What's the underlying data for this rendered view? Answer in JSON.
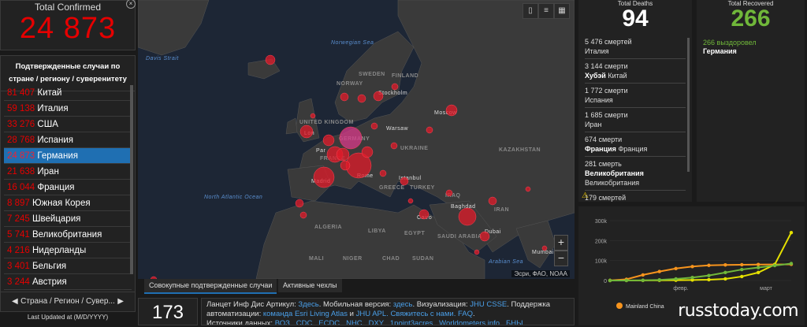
{
  "total_confirmed": {
    "label": "Total Confirmed",
    "value": "24 873"
  },
  "country_list": {
    "header": "Подтвержденные случаи по стране / региону / суверенитету",
    "rows": [
      {
        "value": "81 407",
        "name": "Китай"
      },
      {
        "value": "59 138",
        "name": "Италия"
      },
      {
        "value": "33 276",
        "name": "США"
      },
      {
        "value": "28 768",
        "name": "Испания"
      },
      {
        "value": "24 873",
        "name": "Германия",
        "selected": true
      },
      {
        "value": "21 638",
        "name": "Иран"
      },
      {
        "value": "16 044",
        "name": "Франция"
      },
      {
        "value": "8 897",
        "name": "Южная Корея"
      },
      {
        "value": "7 245",
        "name": "Швейцария"
      },
      {
        "value": "5 741",
        "name": "Великобритания"
      },
      {
        "value": "4 216",
        "name": "Нидерланды"
      },
      {
        "value": "3 401",
        "name": "Бельгия"
      },
      {
        "value": "3 244",
        "name": "Австрия"
      }
    ],
    "footer": "Страна / Регион / Сувер..."
  },
  "last_updated": {
    "label": "Last Updated at (M/D/YYYY)"
  },
  "map": {
    "labels": {
      "norwegian_sea": "Norwegian Sea",
      "davis_strait": "Davis Strait",
      "north_atlantic": "North Atlantic Ocean",
      "arabian_sea": "Arabian Sea",
      "norway": "NORWAY",
      "sweden": "SWEDEN",
      "finland": "FINLAND",
      "stockholm": "Stockholm",
      "moscow": "Moscow",
      "warsaw": "Warsaw",
      "uk": "UNITED KINGDOM",
      "france": "FRANCE",
      "germany": "GERMANY",
      "ukraine": "UKRAINE",
      "kazakhstan": "KAZAKHSTAN",
      "madrid": "Madrid",
      "greece": "GREECE",
      "turkey": "TURKEY",
      "istanbul": "Istanbul",
      "iraq": "IRAQ",
      "baghdad": "Baghdad",
      "algeria": "ALGERIA",
      "libya": "LIBYA",
      "egypt": "EGYPT",
      "saudi": "SAUDI ARABIA",
      "cairo": "Cairo",
      "dubai": "Dubai",
      "mali": "MALI",
      "niger": "NIGER",
      "chad": "CHAD",
      "sudan": "SUDAN",
      "mumbai": "Mumbai",
      "lon": "Lon",
      "par": "Par",
      "rome": "Rome",
      "iran": "IRAN"
    },
    "attribution": "Эсри, ФАО, NOAA",
    "zoom_in": "+",
    "zoom_out": "−"
  },
  "tabs": {
    "cumulative": "Совокупные подтвержденные случаи",
    "active": "Активные чехлы"
  },
  "country_count": "173",
  "info": {
    "line1_a": "Ланцет Инф Дис Артикул:",
    "line1_b": "Здесь",
    "line1_c": ". Мобильная версия:",
    "line1_d": "здесь",
    "line1_e": ". Визуализация:",
    "line1_f": "JHU CSSE",
    "line1_g": ". Поддержка",
    "line2_a": "автоматизации:",
    "line2_b": "команда Esri Living Atlas",
    "line2_c": "и",
    "line2_d": "JHU APL",
    "line2_e": ". Свяжитесь с нами",
    "line2_f": ". FAQ",
    "line2_g": ".",
    "line3_a": "Источники данных:",
    "line3_b": "ВОЗ , CDC , ECDC , NHC , DXY , 1point3acres , Worldometers.info , БНЫ"
  },
  "total_deaths": {
    "label": "Total Deaths",
    "value": "94"
  },
  "deaths_list": [
    {
      "count": "5 476",
      "unit": "смертей",
      "region": "",
      "country": "Италия"
    },
    {
      "count": "3 144",
      "unit": "смерти",
      "region": "Хубэй",
      "country": "Китай"
    },
    {
      "count": "1 772",
      "unit": "смерти",
      "region": "",
      "country": "Испания"
    },
    {
      "count": "1 685",
      "unit": "смерти",
      "region": "",
      "country": "Иран"
    },
    {
      "count": "674",
      "unit": "смерти",
      "region": "Франция",
      "country": "Франция"
    },
    {
      "count": "281",
      "unit": "смерть",
      "region": "Великобритания",
      "country": "Великобритания"
    },
    {
      "count": "179",
      "unit": "смертей",
      "region": "",
      "country": ""
    }
  ],
  "total_recovered": {
    "label": "Total Recovered",
    "value": "266"
  },
  "recovered_list": [
    {
      "count": "266",
      "unit": "выздоровел",
      "country": "Германия"
    }
  ],
  "chart_data": {
    "type": "line",
    "y_ticks": [
      "0",
      "100k",
      "200k",
      "300k"
    ],
    "x_ticks": [
      "февр.",
      "март"
    ],
    "ylim": [
      0,
      300000
    ],
    "legend": [
      "Mainland China"
    ],
    "series": [
      {
        "name": "Mainland China",
        "color": "#f7941d",
        "x": [
          0,
          5,
          10,
          15,
          20,
          25,
          30,
          35,
          40,
          45,
          50,
          55
        ],
        "y": [
          500,
          6000,
          28000,
          45000,
          60000,
          70000,
          76000,
          78000,
          79000,
          80000,
          80500,
          81000
        ]
      },
      {
        "color": "#e5e000",
        "x": [
          0,
          5,
          10,
          15,
          20,
          25,
          30,
          35,
          40,
          45,
          50,
          55
        ],
        "y": [
          0,
          100,
          500,
          1000,
          1500,
          2500,
          4000,
          8000,
          20000,
          40000,
          80000,
          240000
        ]
      },
      {
        "color": "#70b73a",
        "x": [
          0,
          5,
          10,
          15,
          20,
          25,
          30,
          35,
          40,
          45,
          50,
          55
        ],
        "y": [
          0,
          200,
          1000,
          3000,
          8000,
          15000,
          25000,
          40000,
          55000,
          65000,
          75000,
          85000
        ]
      }
    ]
  },
  "watermark": "russtoday.com"
}
